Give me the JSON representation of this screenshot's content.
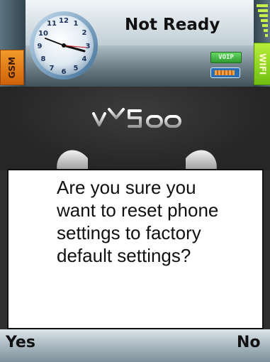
{
  "status": {
    "title": "Not Ready",
    "network_left": "GSM",
    "network_right": "WIFI",
    "voip_label": "VOIP",
    "clock_icon": "analog-clock-icon",
    "battery_icon": "battery-icon",
    "signal_icon": "signal-bars-icon"
  },
  "brand": {
    "logo": "vYSoo"
  },
  "dialog": {
    "lines": [
      "Are you sure you",
      "want to reset phone",
      "settings to factory",
      "default settings?"
    ]
  },
  "softkeys": {
    "left": "Yes",
    "right": "No"
  },
  "colors": {
    "gsm": "#e07a14",
    "wifi": "#8fd42a",
    "voip": "#3fb43f",
    "background": "#2f2f2f"
  }
}
